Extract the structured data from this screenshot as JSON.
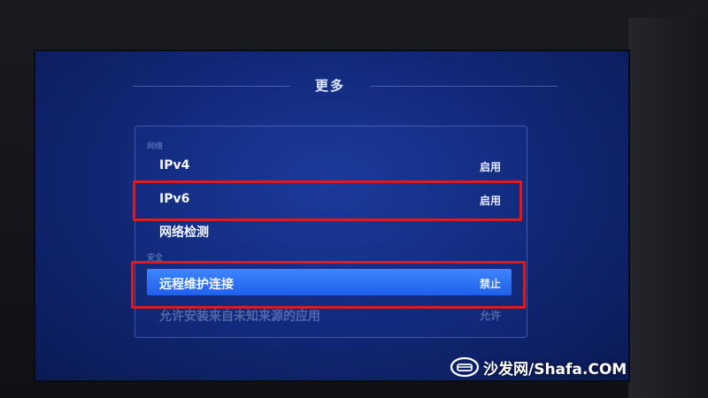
{
  "page": {
    "title": "更多"
  },
  "sections": {
    "network_label": "网络",
    "security_label": "安全"
  },
  "rows": [
    {
      "label": "IPv4",
      "value": "启用"
    },
    {
      "label": "IPv6",
      "value": "启用"
    },
    {
      "label": "网络检测",
      "value": ""
    },
    {
      "label": "远程维护连接",
      "value": "禁止"
    },
    {
      "label": "允许安装来自未知来源的应用",
      "value": "允许"
    }
  ],
  "watermark": {
    "text": "沙发网/Shafa.COM",
    "icon": "sofa-logo-icon"
  },
  "colors": {
    "screen_blue": "#12297a",
    "selected_blue": "#2f72f5",
    "annotation_red": "#e01a1a"
  }
}
